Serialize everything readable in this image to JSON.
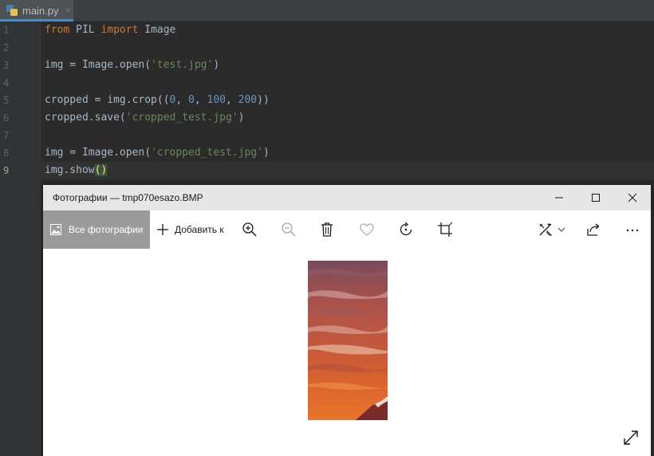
{
  "ide": {
    "tab": {
      "filename": "main.py",
      "close": "×"
    },
    "lines": [
      {
        "num": "1"
      },
      {
        "num": "2"
      },
      {
        "num": "3"
      },
      {
        "num": "4"
      },
      {
        "num": "5"
      },
      {
        "num": "6"
      },
      {
        "num": "7"
      },
      {
        "num": "8"
      },
      {
        "num": "9"
      }
    ],
    "code": {
      "l1": {
        "kw_from": "from",
        "module": " PIL ",
        "kw_import": "import",
        "name": " Image"
      },
      "l3": {
        "pre": "img = Image.open(",
        "str": "'test.jpg'",
        "post": ")"
      },
      "l5": {
        "pre": "cropped = img.crop((",
        "n1": "0",
        "c1": ", ",
        "n2": "0",
        "c2": ", ",
        "n3": "100",
        "c3": ", ",
        "n4": "200",
        "post": "))"
      },
      "l6": {
        "pre": "cropped.save(",
        "str": "'cropped_test.jpg'",
        "post": ")"
      },
      "l8": {
        "pre": "img = Image.open(",
        "str": "'cropped_test.jpg'",
        "post": ")"
      },
      "l9": {
        "pre": "img.show",
        "parens": "()"
      }
    },
    "colors": {
      "background": "#2b2b2b",
      "keyword": "#cc7832",
      "string": "#6a8759",
      "number": "#6897bb",
      "text": "#a9b7c6"
    }
  },
  "photos_app": {
    "title": "Фотографии — tmp070esazo.BMP",
    "window_buttons": [
      "minimize-icon",
      "maximize-icon",
      "close-icon"
    ],
    "toolbar": {
      "all_photos": "Все фотографии",
      "add_to": "Добавить к",
      "icons": [
        "zoom-in-icon",
        "zoom-out-icon",
        "delete-icon",
        "favorite-icon",
        "rotate-icon",
        "crop-icon",
        "edit-icon",
        "share-icon",
        "more-icon"
      ]
    },
    "colors": {
      "titlebar": "#e6e6e6",
      "selected_tab": "#9b9b9b"
    }
  }
}
